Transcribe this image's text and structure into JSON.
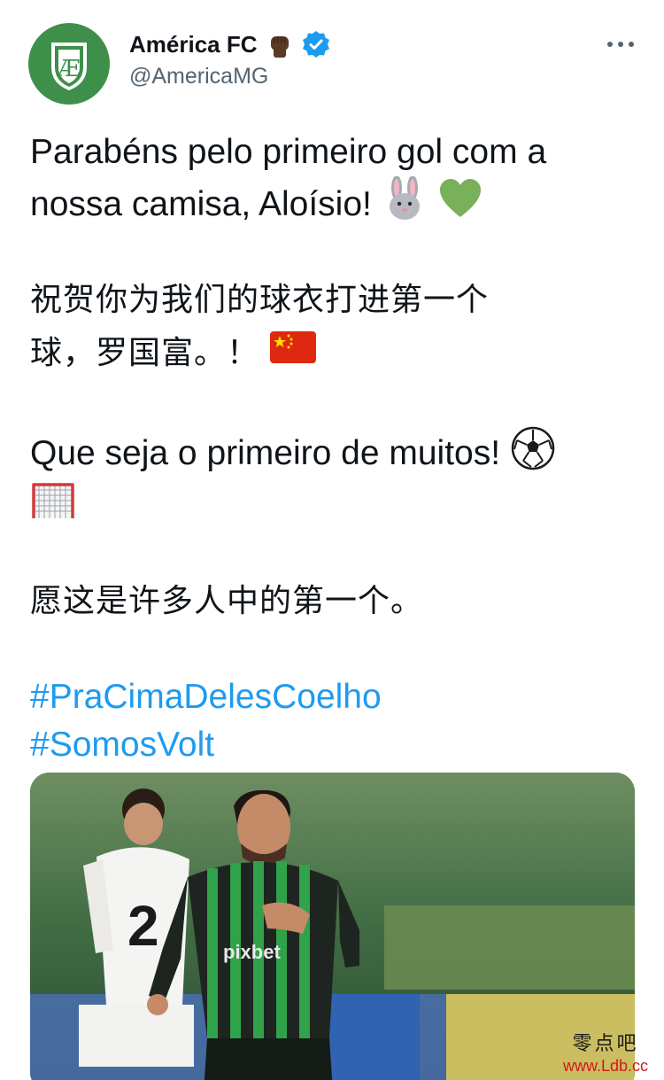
{
  "account": {
    "display_name": "América FC",
    "handle": "@AmericaMG",
    "verified": true,
    "avatar_icon": "america-fc-crest",
    "accent_color": "#3e8f4a",
    "badge_emoji": "raised-fist-dark-skin"
  },
  "tweet": {
    "lines": [
      {
        "text": "Parabéns pelo primeiro gol com a"
      },
      {
        "text": "nossa camisa, Aloísio!"
      },
      {
        "text": "祝贺你为我们的球衣打进第一个"
      },
      {
        "text": "球，罗国富。！"
      },
      {
        "text": "Que seja o primeiro de muitos!"
      },
      {
        "text": "愿这是许多人中的第一个。"
      }
    ],
    "emojis": [
      "rabbit-face",
      "green-heart",
      "china-flag",
      "soccer-ball",
      "goal-net"
    ],
    "hashtags": [
      "#PraCimaDelesCoelho",
      "#SomosVolt"
    ],
    "hashtag_color": "#1d9bf0"
  },
  "media": {
    "description": "player-celebrating",
    "jersey_sponsor": "pixbet",
    "opponent_number": "2"
  },
  "watermark": {
    "top": "零点吧",
    "bottom": "www.Ldb.cc"
  }
}
